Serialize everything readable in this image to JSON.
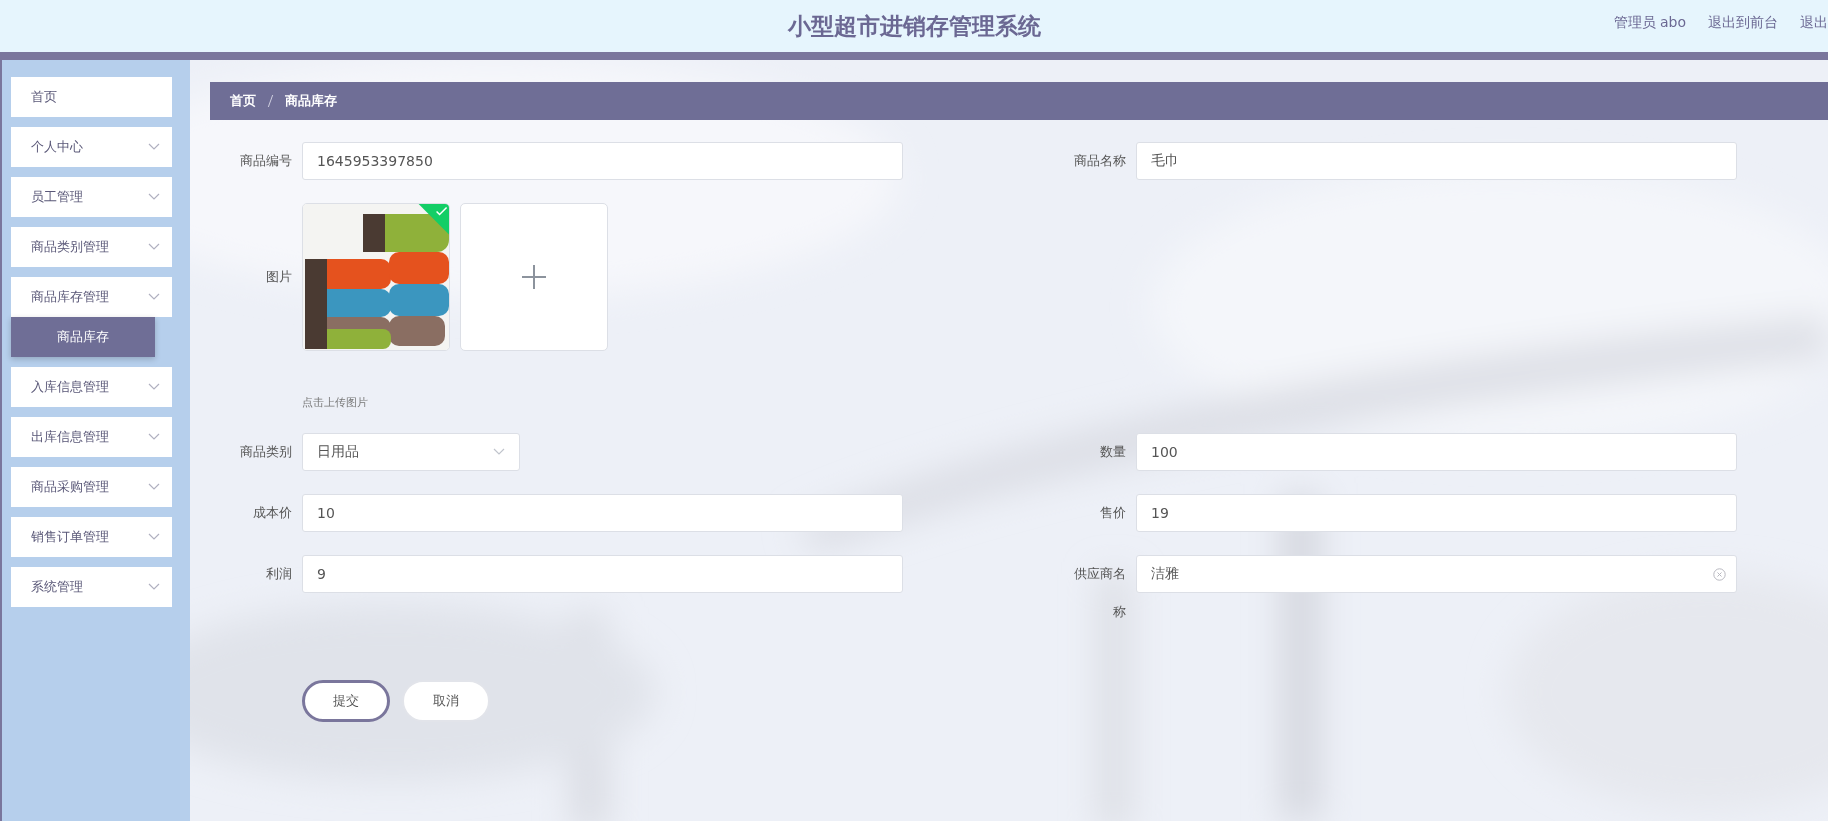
{
  "header": {
    "title": "小型超市进销存管理系统",
    "user": "管理员 abo",
    "links": [
      "退出到前台",
      "退出"
    ]
  },
  "sidebar": {
    "items": [
      {
        "label": "首页",
        "kind": "link"
      },
      {
        "label": "个人中心",
        "kind": "menu"
      },
      {
        "label": "员工管理",
        "kind": "menu"
      },
      {
        "label": "商品类别管理",
        "kind": "menu"
      },
      {
        "label": "商品库存管理",
        "kind": "menu",
        "children": [
          {
            "label": "商品库存",
            "selected": true
          }
        ]
      },
      {
        "label": "入库信息管理",
        "kind": "menu"
      },
      {
        "label": "出库信息管理",
        "kind": "menu"
      },
      {
        "label": "商品采购管理",
        "kind": "menu"
      },
      {
        "label": "销售订单管理",
        "kind": "menu"
      },
      {
        "label": "系统管理",
        "kind": "menu"
      }
    ]
  },
  "breadcrumb": [
    "首页",
    "商品库存"
  ],
  "form": {
    "rows": [
      [
        {
          "label": "商品编号",
          "kind": "text",
          "value": "1645953397850"
        },
        {
          "label": "商品名称",
          "kind": "text",
          "value": "毛巾"
        }
      ],
      [
        {
          "label": "图片",
          "hint": "点击上传图片"
        }
      ],
      [
        {
          "label": "商品类别",
          "kind": "select",
          "value": "日用品"
        },
        {
          "label": "数量",
          "kind": "text",
          "value": "100"
        }
      ],
      [
        {
          "label": "成本价",
          "kind": "text",
          "value": "10"
        },
        {
          "label": "售价",
          "kind": "text",
          "value": "19"
        }
      ],
      [
        {
          "label": "利润",
          "kind": "text",
          "value": "9"
        },
        {
          "label": "供应商名称",
          "kind": "clearable",
          "value": "洁雅"
        }
      ]
    ],
    "buttons": [
      {
        "label": "提交",
        "kind": "primary"
      },
      {
        "label": "取消",
        "kind": "default"
      }
    ]
  }
}
